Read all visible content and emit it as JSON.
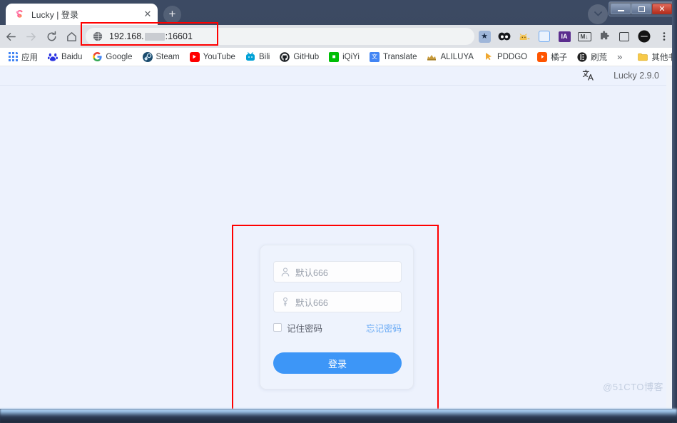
{
  "window": {
    "caption_buttons": [
      {
        "name": "minimize",
        "label": "–"
      },
      {
        "name": "maximize",
        "label": "□"
      },
      {
        "name": "close",
        "label": "✕"
      }
    ]
  },
  "browser": {
    "tab": {
      "title": "Lucky | 登录",
      "favicon_name": "lucky-favicon",
      "close_label": "✕"
    },
    "new_tab_label": "+",
    "tab_list_label": "▼",
    "nav": {
      "back_label": "←",
      "forward_label": "→",
      "reload_label": "↻",
      "home_label": "⌂"
    },
    "omnibox": {
      "url_prefix": "192.168.",
      "url_suffix": ":16601",
      "site_icon_name": "globe-icon"
    },
    "toolbar_icons": [
      {
        "name": "bookmark-star-icon",
        "glyph": "★"
      },
      {
        "name": "panda-extension-icon",
        "glyph": "●●"
      },
      {
        "name": "cat-extension-icon",
        "glyph": "🐱"
      },
      {
        "name": "blue-extension-icon",
        "glyph": "▣"
      },
      {
        "name": "ia-extension-icon",
        "glyph": "IA"
      },
      {
        "name": "markdown-extension-icon",
        "glyph": "M↓"
      },
      {
        "name": "extensions-puzzle-icon",
        "glyph": "❖"
      },
      {
        "name": "side-panel-icon",
        "glyph": "□"
      },
      {
        "name": "profile-avatar",
        "glyph": "●"
      },
      {
        "name": "chrome-menu-icon",
        "glyph": "⋮"
      }
    ],
    "bookmarks": [
      {
        "name": "apps",
        "label": "应用",
        "icon": "apps-grid-icon",
        "color": "#4285f4",
        "glyph": "∷"
      },
      {
        "name": "baidu",
        "label": "Baidu",
        "icon": "baidu-icon",
        "color": "#2932e1",
        "glyph": "熊"
      },
      {
        "name": "google",
        "label": "Google",
        "icon": "google-icon",
        "color": "#ffffff",
        "glyph": "G"
      },
      {
        "name": "steam",
        "label": "Steam",
        "icon": "steam-icon",
        "color": "#1b2838",
        "glyph": "◌"
      },
      {
        "name": "youtube",
        "label": "YouTube",
        "icon": "youtube-icon",
        "color": "#ff0000",
        "glyph": "▶"
      },
      {
        "name": "bili",
        "label": "Bili",
        "icon": "bilibili-icon",
        "color": "#00a1d6",
        "glyph": "▢"
      },
      {
        "name": "github",
        "label": "GitHub",
        "icon": "github-icon",
        "color": "#24292e",
        "glyph": "●"
      },
      {
        "name": "iqiyi",
        "label": "iQiYi",
        "icon": "iqiyi-icon",
        "color": "#00be06",
        "glyph": "▬"
      },
      {
        "name": "translate",
        "label": "Translate",
        "icon": "translate-icon",
        "color": "#4285f4",
        "glyph": "文"
      },
      {
        "name": "aliluya",
        "label": "ALILUYA",
        "icon": "aliluya-icon",
        "color": "#c89b3c",
        "glyph": "♛"
      },
      {
        "name": "pddgo",
        "label": "PDDGO",
        "icon": "pddgo-icon",
        "color": "#f5a623",
        "glyph": "➤"
      },
      {
        "name": "juzi",
        "label": "橘子",
        "icon": "juzi-icon",
        "color": "#ff5500",
        "glyph": "▶"
      },
      {
        "name": "shuahuang",
        "label": "刷荒",
        "icon": "shuahuang-icon",
        "color": "#2b2b2b",
        "glyph": "◐"
      }
    ],
    "bookmarks_overflow_label": "»",
    "other_bookmarks": {
      "label": "其他书签",
      "icon": "folder-icon",
      "color": "#f7c948",
      "glyph": "▭"
    }
  },
  "page": {
    "header": {
      "lang_icon_name": "translate-language-icon",
      "lang_glyph": "文A",
      "version": "Lucky 2.9.0"
    },
    "login": {
      "username": {
        "placeholder": "默认666",
        "icon": "user-icon",
        "value": ""
      },
      "password": {
        "placeholder": "默认666",
        "icon": "key-icon",
        "value": ""
      },
      "remember_label": "记住密码",
      "remember_checked": false,
      "forgot_label": "忘记密码",
      "submit_label": "登录"
    },
    "watermark": "@51CTO博客"
  },
  "annotations": {
    "url_box_color": "#ff0000",
    "login_box_color": "#ff0000"
  },
  "colors": {
    "accent": "#3d96f7",
    "link": "#67a9f5",
    "page_bg": "#edf2fd",
    "card_bg": "#eef3fd"
  }
}
